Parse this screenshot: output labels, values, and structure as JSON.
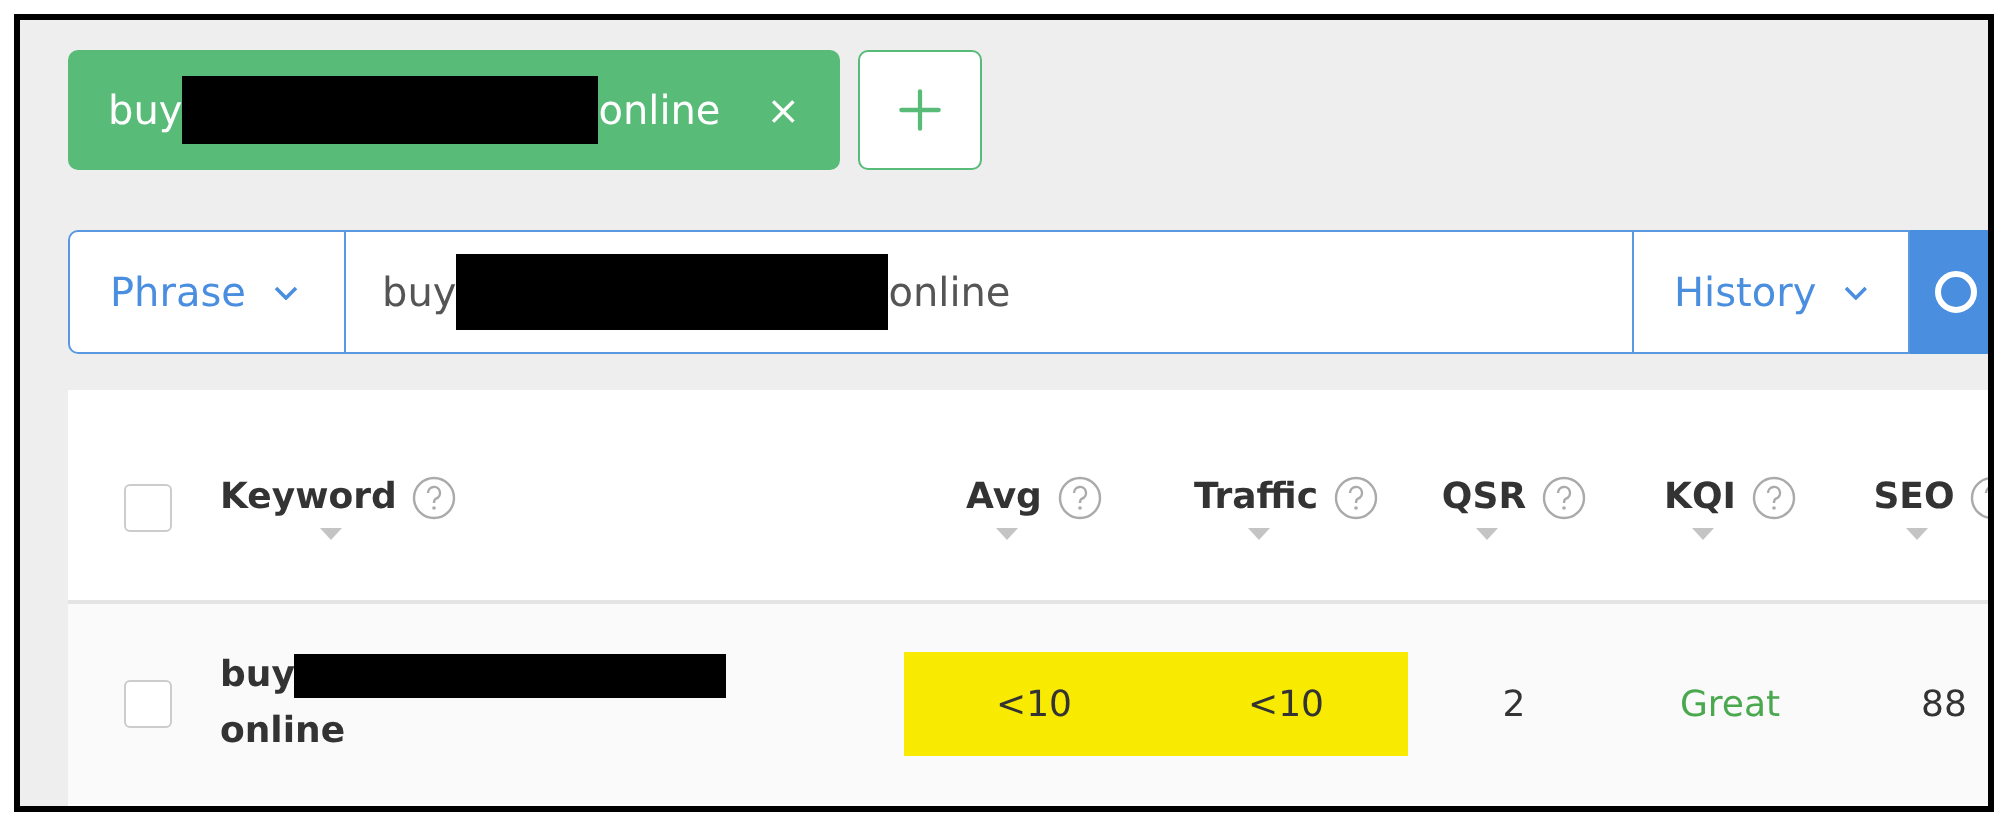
{
  "tags": [
    {
      "parts": [
        {
          "kind": "text",
          "text": "buy"
        },
        {
          "kind": "redaction"
        },
        {
          "kind": "text",
          "text": "online"
        }
      ],
      "close": "×"
    }
  ],
  "search": {
    "mode": "Phrase",
    "value_parts": [
      {
        "kind": "text",
        "text": "buy"
      },
      {
        "kind": "redaction"
      },
      {
        "kind": "text",
        "text": "online"
      }
    ],
    "history": "History"
  },
  "table": {
    "columns": [
      {
        "label": "Keyword"
      },
      {
        "label": "Avg"
      },
      {
        "label": "Traffic"
      },
      {
        "label": "QSR"
      },
      {
        "label": "KQI"
      },
      {
        "label": "SEO"
      }
    ],
    "header_checked": false,
    "rows": [
      {
        "checked": false,
        "cells": [
          {
            "kind": "keyword",
            "parts": [
              {
                "kind": "text",
                "text": "buy"
              },
              {
                "kind": "redaction"
              },
              {
                "kind": "break"
              },
              {
                "kind": "text",
                "text": "online"
              }
            ]
          },
          {
            "kind": "value",
            "text": "<10",
            "highlighted": true
          },
          {
            "kind": "value",
            "text": "<10",
            "highlighted": true
          },
          {
            "kind": "value",
            "text": "2",
            "highlighted": false
          },
          {
            "kind": "value",
            "text": "Great",
            "highlighted": false,
            "color": "#4aa84f"
          },
          {
            "kind": "value",
            "text": "88",
            "highlighted": false
          }
        ]
      }
    ]
  }
}
